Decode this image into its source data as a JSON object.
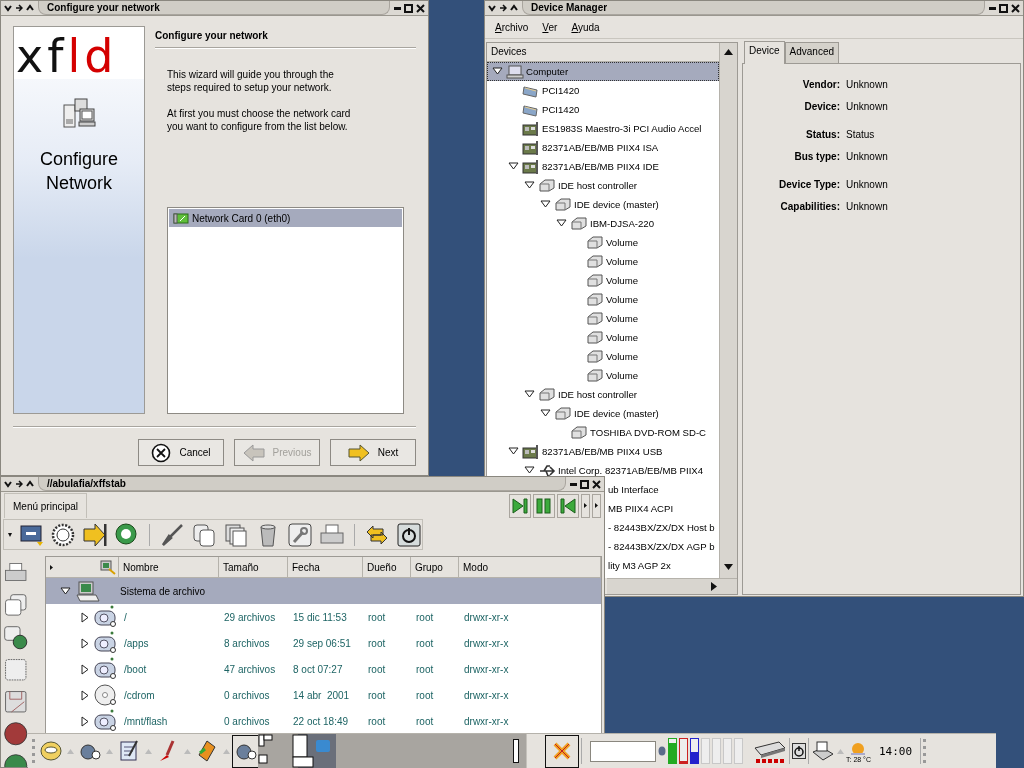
{
  "wizard": {
    "title": "Configure your network",
    "logo": [
      {
        "text": "xf",
        "color": "#111111"
      },
      {
        "text": "ld",
        "color": "#d40000"
      }
    ],
    "side_title": "Configure Network",
    "heading": "Configure your network",
    "paragraphs": [
      "This wizard will guide you through the steps required to setup your network.",
      "At first you must choose the network card you want to configure from the list below."
    ],
    "cards": [
      {
        "label": "Network Card 0 (eth0)",
        "selected": true
      }
    ],
    "buttons": [
      {
        "label": "Cancel",
        "kind": "cancel",
        "disabled": false
      },
      {
        "label": "Previous",
        "kind": "previous",
        "disabled": true
      },
      {
        "label": "Next",
        "kind": "next",
        "disabled": false
      }
    ]
  },
  "device_manager": {
    "title": "Device Manager",
    "menu": [
      "Archivo",
      "Ver",
      "Ayuda"
    ],
    "tree_header": "Devices",
    "tree": [
      {
        "label": "Computer",
        "kind": "computer",
        "expanded": true,
        "selected": true,
        "children": [
          {
            "label": "PCI1420",
            "kind": "card",
            "selected": false
          },
          {
            "label": "PCI1420",
            "kind": "card",
            "selected": false
          },
          {
            "label": "ES1983S Maestro-3i PCI Audio Accel",
            "kind": "board",
            "selected": false
          },
          {
            "label": "82371AB/EB/MB PIIX4 ISA",
            "kind": "board",
            "selected": false
          },
          {
            "label": "82371AB/EB/MB PIIX4 IDE",
            "kind": "board",
            "expanded": true,
            "selected": false,
            "children": [
              {
                "label": "IDE host controller",
                "kind": "disk",
                "expanded": true,
                "selected": false,
                "children": [
                  {
                    "label": "IDE device (master)",
                    "kind": "disk",
                    "expanded": true,
                    "selected": false,
                    "children": [
                      {
                        "label": "IBM-DJSA-220",
                        "kind": "disk",
                        "expanded": true,
                        "selected": false,
                        "children": [
                          {
                            "label": "Volume",
                            "kind": "disk",
                            "selected": false
                          },
                          {
                            "label": "Volume",
                            "kind": "disk",
                            "selected": false
                          },
                          {
                            "label": "Volume",
                            "kind": "disk",
                            "selected": false
                          },
                          {
                            "label": "Volume",
                            "kind": "disk",
                            "selected": false
                          },
                          {
                            "label": "Volume",
                            "kind": "disk",
                            "selected": false
                          },
                          {
                            "label": "Volume",
                            "kind": "disk",
                            "selected": false
                          },
                          {
                            "label": "Volume",
                            "kind": "disk",
                            "selected": false
                          },
                          {
                            "label": "Volume",
                            "kind": "disk",
                            "selected": false
                          }
                        ]
                      }
                    ]
                  }
                ]
              },
              {
                "label": "IDE host controller",
                "kind": "disk",
                "expanded": true,
                "selected": false,
                "children": [
                  {
                    "label": "IDE device (master)",
                    "kind": "disk",
                    "expanded": true,
                    "selected": false,
                    "children": [
                      {
                        "label": "TOSHIBA DVD-ROM SD-C",
                        "kind": "disk",
                        "selected": false
                      }
                    ]
                  }
                ]
              }
            ]
          },
          {
            "label": "82371AB/EB/MB PIIX4 USB",
            "kind": "board",
            "expanded": true,
            "selected": false,
            "children": [
              {
                "label": "Intel Corp. 82371AB/EB/MB PIIX4",
                "kind": "usb",
                "expanded": true,
                "selected": false
              }
            ]
          }
        ]
      }
    ],
    "tree_fragments": [
      "ub Interface",
      "MB PIIX4 ACPI",
      "- 82443BX/ZX/DX Host b",
      "- 82443BX/ZX/DX AGP b",
      "lity M3 AGP 2x"
    ],
    "tabs": [
      {
        "label": "Device",
        "selected": true
      },
      {
        "label": "Advanced",
        "selected": false
      }
    ],
    "properties": [
      {
        "label": "Vendor:",
        "value": "Unknown"
      },
      {
        "label": "Device:",
        "value": "Unknown"
      },
      {
        "label": "Status:",
        "value": "Status"
      },
      {
        "label": "Bus type:",
        "value": "Unknown"
      },
      {
        "label": "Device Type:",
        "value": "Unknown"
      },
      {
        "label": "Capabilities:",
        "value": "Unknown"
      }
    ]
  },
  "file_manager": {
    "title": "//abulafia/xffstab",
    "menu_button": "Menú principal",
    "columns": [
      "Nombre",
      "Tamaño",
      "Fecha",
      "Dueño",
      "Grupo",
      "Modo"
    ],
    "group": {
      "label": "Sistema de archivo",
      "expanded": true
    },
    "rows": [
      {
        "name": "/",
        "kind": "disk",
        "size": "29 archivos",
        "date": "15 dic 11:53",
        "owner": "root",
        "group": "root",
        "mode": "drwxr-xr-x",
        "expanded": false
      },
      {
        "name": "/apps",
        "kind": "disk",
        "size": "8 archivos",
        "date": "29 sep 06:51",
        "owner": "root",
        "group": "root",
        "mode": "drwxr-xr-x",
        "expanded": false
      },
      {
        "name": "/boot",
        "kind": "disk",
        "size": "47 archivos",
        "date": "8 oct 07:27",
        "owner": "root",
        "group": "root",
        "mode": "drwxr-xr-x",
        "expanded": false
      },
      {
        "name": "/cdrom",
        "kind": "cdrom",
        "size": "0 archivos",
        "date": "14 abr  2001",
        "owner": "root",
        "group": "root",
        "mode": "drwxr-xr-x",
        "expanded": false
      },
      {
        "name": "/mnt/flash",
        "kind": "disk",
        "size": "0 archivos",
        "date": "22 oct 18:49",
        "owner": "root",
        "group": "root",
        "mode": "drwxr-xr-x",
        "expanded": false
      }
    ]
  },
  "taskbar": {
    "meters": [
      {
        "level": 0.85,
        "color": "#22aa22"
      },
      {
        "level": 0.1,
        "color": "#cc2222"
      },
      {
        "level": 0.45,
        "color": "#2222cc"
      },
      {
        "level": 0,
        "color": "#c8c8c8"
      },
      {
        "level": 0,
        "color": "#c8c8c8"
      },
      {
        "level": 0,
        "color": "#c8c8c8"
      },
      {
        "level": 0,
        "color": "#c8c8c8"
      }
    ],
    "weather": "T: 28 °C",
    "clock": "14:00"
  }
}
